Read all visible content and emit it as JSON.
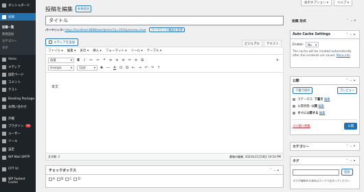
{
  "sidebar": {
    "items": [
      {
        "label": "ダッシュボード"
      },
      {
        "label": "投稿"
      },
      {
        "label": "Voice"
      },
      {
        "label": "メディア"
      },
      {
        "label": "固定ページ"
      },
      {
        "label": "コメント"
      },
      {
        "label": "テスト"
      },
      {
        "label": "Booking Package"
      },
      {
        "label": "お問い合わせ"
      },
      {
        "label": "外観"
      },
      {
        "label": "プラグイン",
        "badge": "16"
      },
      {
        "label": "ユーザー"
      },
      {
        "label": "ツール"
      },
      {
        "label": "設定"
      },
      {
        "label": "WP Mail SMTP"
      },
      {
        "label": "CPT UI"
      },
      {
        "label": "WP Fastest Cache"
      }
    ],
    "sub_items": [
      "投稿一覧",
      "新規追加",
      "カテゴリー",
      "タグ"
    ]
  },
  "top": {
    "screen_options": "表示オプション ▾",
    "help": "ヘルプ ▾"
  },
  "page": {
    "title": "投稿を編集",
    "add_new": "新規追加"
  },
  "post": {
    "title": "タイトル",
    "permalink_label": "パーマリンク:",
    "permalink_url": "https://localhost:8888/wordpress/?p=191&preview=true",
    "permalink_button": "パーマリンク構造を変更",
    "body_text": "本文"
  },
  "editor": {
    "add_media": "メディアを追加",
    "tab_visual": "ビジュアル",
    "tab_text": "テキスト",
    "menus": [
      "ファイル ▾",
      "編集 ▾",
      "表示 ▾",
      "挿入 ▾",
      "フォーマット ▾",
      "ツール ▾",
      "テーブル ▾"
    ],
    "format_select": "段落",
    "font_select": "Georgia",
    "size_select": "12pt",
    "row1_tools": [
      "B",
      "I",
      "≔",
      "≔",
      "❝",
      "≡",
      "≡",
      "≡",
      "⚯",
      "≡",
      "⊞",
      "✕"
    ],
    "row2_tools": [
      "S",
      "―",
      "A",
      "⊡",
      "Ω",
      "⇤",
      "⇥",
      "↶",
      "↷",
      "?"
    ],
    "word_count": "文字数: 2",
    "last_edited": "最後の編集: 2022年11月18日 10:54 PM"
  },
  "checkbox_panel": {
    "title": "チェックボックス",
    "options": [
      "A",
      "B",
      "C",
      "D"
    ]
  },
  "format_box": {
    "title": "投稿 形式"
  },
  "auto_cache": {
    "title": "Auto Cache Settings",
    "enable_label": "Enable:",
    "enable_value": "No",
    "desc": "The cache will be created automatically after the contents are saved.",
    "more_info": "More info"
  },
  "publish": {
    "title": "公開",
    "save_draft": "下書き保存",
    "preview": "プレビュー",
    "status_label": "ステータス:",
    "status_value": "下書き",
    "edit": "編集",
    "visibility_label": "公開状態:",
    "visibility_value": "公開",
    "schedule_value": "すぐに公開する",
    "trash": "ゴミ箱へ移動",
    "publish_btn": "公開"
  },
  "categories": {
    "title": "カテゴリー"
  },
  "tags": {
    "title": "タグ",
    "add_button": "追加",
    "hint": "タグが複数ある場合はコンマで区切ってください"
  }
}
